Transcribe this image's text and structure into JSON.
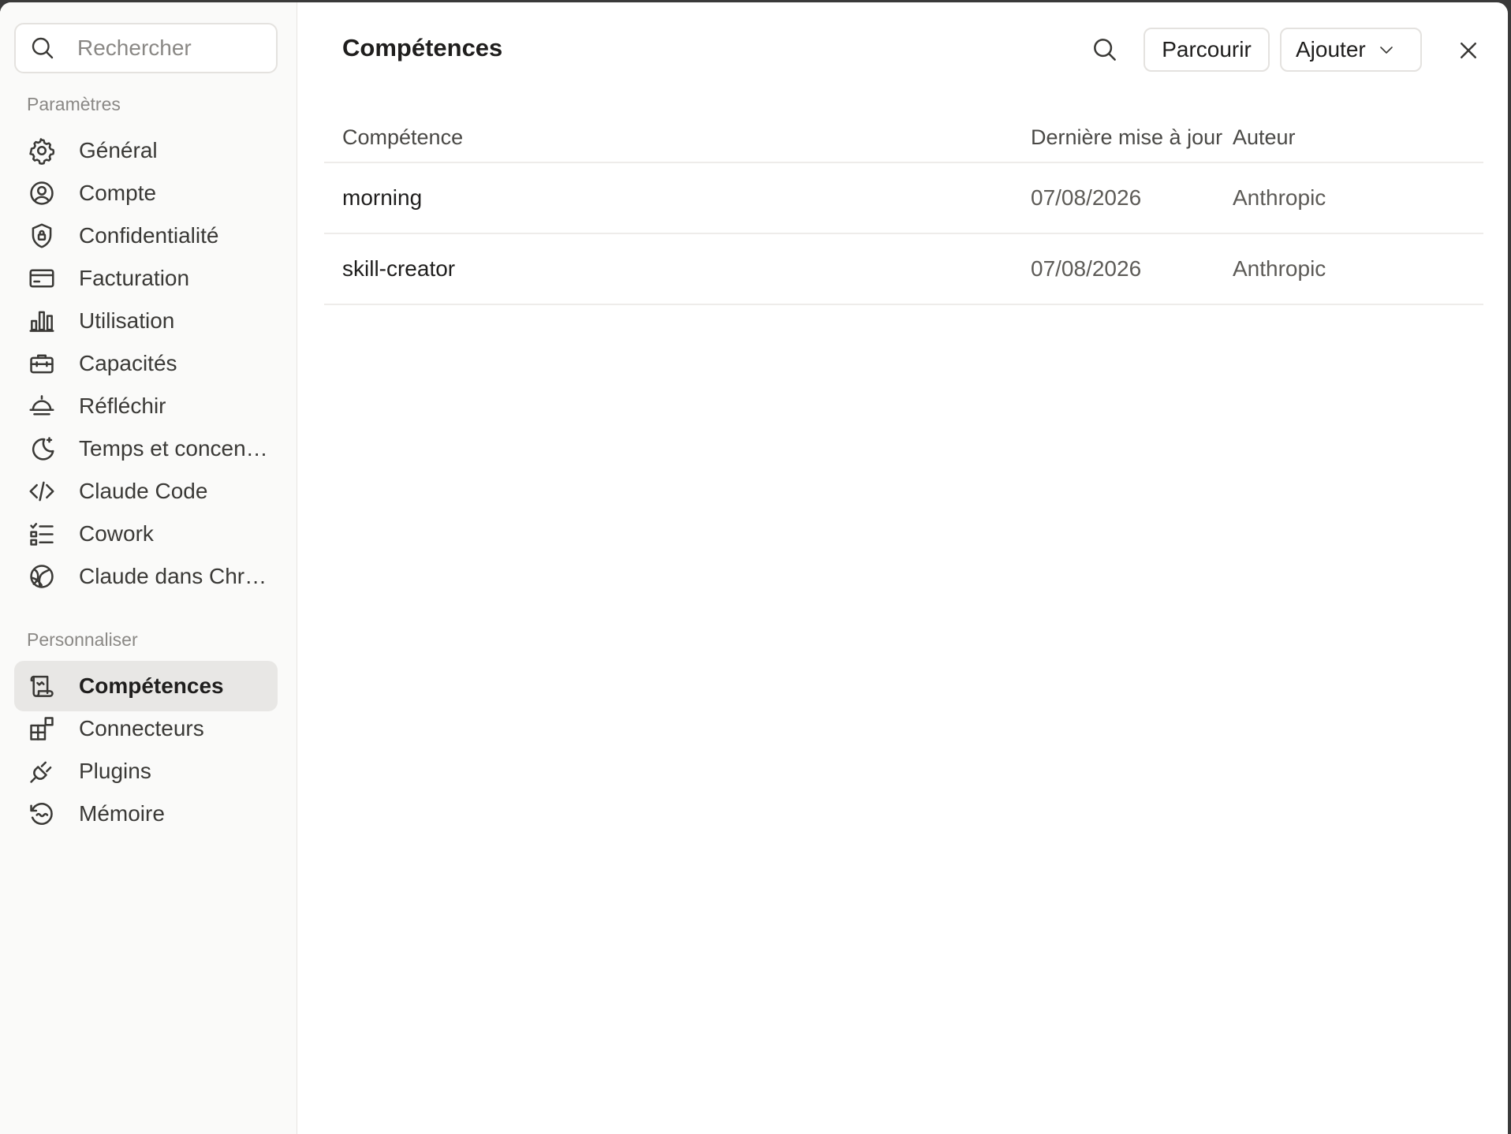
{
  "sidebar": {
    "search_placeholder": "Rechercher",
    "sections": [
      {
        "label": "Paramètres",
        "items": [
          {
            "label": "Général",
            "icon": "gear-icon"
          },
          {
            "label": "Compte",
            "icon": "user-circle-icon"
          },
          {
            "label": "Confidentialité",
            "icon": "shield-lock-icon"
          },
          {
            "label": "Facturation",
            "icon": "credit-card-icon"
          },
          {
            "label": "Utilisation",
            "icon": "bar-chart-icon"
          },
          {
            "label": "Capacités",
            "icon": "briefcase-icon"
          },
          {
            "label": "Réfléchir",
            "icon": "sunset-icon"
          },
          {
            "label": "Temps et concentration",
            "icon": "moon-star-icon"
          },
          {
            "label": "Claude Code",
            "icon": "code-icon"
          },
          {
            "label": "Cowork",
            "icon": "checklist-icon"
          },
          {
            "label": "Claude dans Chrome",
            "icon": "globe-icon"
          }
        ]
      },
      {
        "label": "Personnaliser",
        "items": [
          {
            "label": "Compétences",
            "icon": "scroll-icon",
            "active": true
          },
          {
            "label": "Connecteurs",
            "icon": "blocks-icon"
          },
          {
            "label": "Plugins",
            "icon": "plug-icon"
          },
          {
            "label": "Mémoire",
            "icon": "memory-icon"
          }
        ]
      }
    ]
  },
  "main": {
    "title": "Compétences",
    "browse_label": "Parcourir",
    "add_label": "Ajouter",
    "table": {
      "headers": [
        "Compétence",
        "Dernière mise à jour",
        "Auteur"
      ],
      "rows": [
        [
          "morning",
          "07/08/2026",
          "Anthropic"
        ],
        [
          "skill-creator",
          "07/08/2026",
          "Anthropic"
        ]
      ]
    }
  }
}
